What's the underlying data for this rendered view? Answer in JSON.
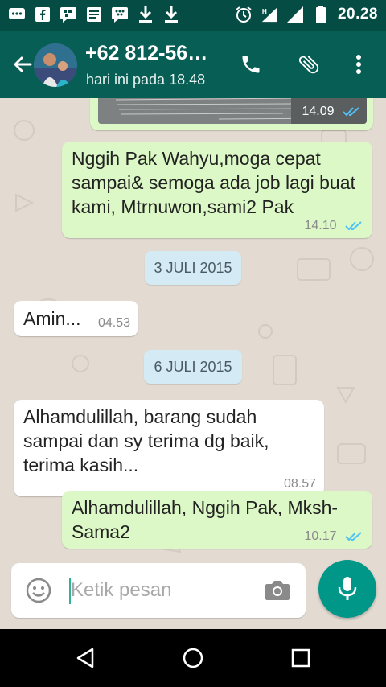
{
  "status_bar": {
    "time": "20.28"
  },
  "header": {
    "contact_name": "+62 812-56…",
    "last_seen": "hari ini pada 18.48"
  },
  "messages": [
    {
      "time": "14.09"
    },
    {
      "text": "Nggih Pak Wahyu,moga cepat sampai& semoga ada job lagi buat kami, Mtrnuwon,sami2 Pak",
      "time": "14.10"
    },
    {
      "date": "3 JULI 2015"
    },
    {
      "text": "Amin...",
      "time": "04.53"
    },
    {
      "date": "6 JULI 2015"
    },
    {
      "text": "Alhamdulillah, barang sudah sampai dan sy terima dg baik, terima kasih...",
      "time": "08.57"
    },
    {
      "text": "Alhamdulillah, Nggih Pak, Mksh-Sama2",
      "time": "10.17"
    }
  ],
  "composer": {
    "placeholder": "Ketik pesan"
  },
  "colors": {
    "header": "#075e54",
    "status": "#054d44",
    "outgoing": "#dcf8c6",
    "incoming": "#ffffff",
    "date_pill": "#d4eaf4",
    "fab": "#009688",
    "read_ticks": "#4fc3f7"
  }
}
